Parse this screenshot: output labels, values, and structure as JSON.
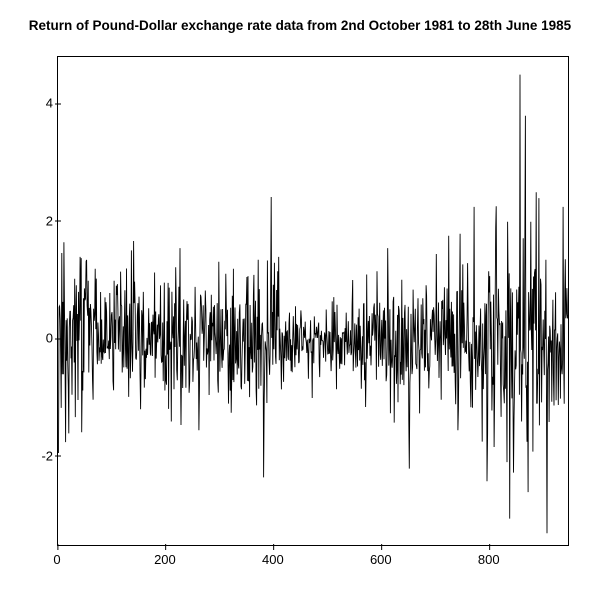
{
  "chart_data": {
    "type": "line",
    "title": "Return of Pound-Dollar exchange rate data from 2nd October 1981 to 28th June 1985",
    "xlabel": "",
    "ylabel": "",
    "xlim": [
      0,
      945
    ],
    "ylim": [
      -3.5,
      4.8
    ],
    "xticks": [
      0,
      200,
      400,
      600,
      800
    ],
    "yticks": [
      -2,
      0,
      2,
      4
    ],
    "n_points": 945,
    "seed": 1981,
    "base_sd": 0.5,
    "cluster_phases": [
      {
        "start": 0,
        "end": 60,
        "sd": 0.7
      },
      {
        "start": 60,
        "end": 200,
        "sd": 0.5
      },
      {
        "start": 200,
        "end": 260,
        "sd": 0.6
      },
      {
        "start": 260,
        "end": 370,
        "sd": 0.5
      },
      {
        "start": 370,
        "end": 420,
        "sd": 0.58
      },
      {
        "start": 420,
        "end": 560,
        "sd": 0.3
      },
      {
        "start": 560,
        "end": 650,
        "sd": 0.55
      },
      {
        "start": 650,
        "end": 760,
        "sd": 0.55
      },
      {
        "start": 760,
        "end": 830,
        "sd": 0.75
      },
      {
        "start": 830,
        "end": 900,
        "sd": 1.1
      },
      {
        "start": 900,
        "end": 945,
        "sd": 0.75
      }
    ],
    "extreme_points": {
      "10": 1.65,
      "13": -1.75,
      "40": 1.4,
      "68": 1.2,
      "115": 1.15,
      "225": 1.55,
      "260": -1.55,
      "320": -1.25,
      "370": 1.35,
      "380": -2.35,
      "400": 1.3,
      "470": -1.0,
      "515": -0.85,
      "610": 1.55,
      "650": -2.2,
      "700": 1.45,
      "740": -1.55,
      "770": 2.25,
      "795": -1.6,
      "855": 4.5,
      "858": -1.4,
      "865": 3.8,
      "870": -2.6,
      "885": 2.5,
      "905": -3.3,
      "935": 2.25
    }
  }
}
